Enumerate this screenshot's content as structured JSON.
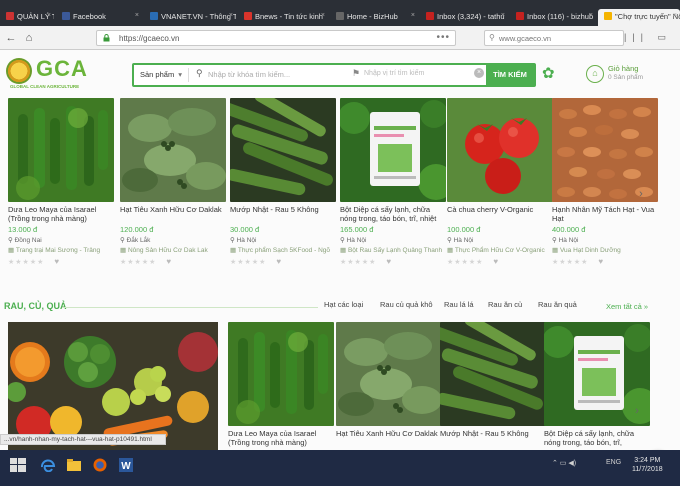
{
  "browser": {
    "tabs": [
      {
        "label": "QUẢN LÝ TÒA S",
        "icon": "page-icon",
        "color": "#cc3333"
      },
      {
        "label": "Facebook",
        "icon": "facebook-icon",
        "color": "#3b5998"
      },
      {
        "label": "VNANET.VN - Thông Tấn",
        "icon": "page-icon",
        "color": "#2a6db5"
      },
      {
        "label": "Bnews - Tin tức kinh",
        "icon": "page-icon",
        "color": "#d9342b"
      },
      {
        "label": "Home - BizHub",
        "icon": "page-icon",
        "color": "#666666"
      },
      {
        "label": "Inbox (3,324) - tathu",
        "icon": "mail-icon",
        "color": "#c5221f"
      },
      {
        "label": "Inbox (116) - bizhub",
        "icon": "mail-icon",
        "color": "#c5221f"
      },
      {
        "label": "\"Chợ trực tuyến\" Nô",
        "icon": "page-icon",
        "color": "#f5b400"
      }
    ],
    "url": "https://gcaeco.vn",
    "search_query": "www.gcaeco.vn"
  },
  "site": {
    "logo_text": "GCA",
    "logo_sub": "GLOBAL CLEAN AGRICULTURE",
    "search": {
      "category": "Sản phẩm",
      "keyword_placeholder": "Nhập từ khóa tìm kiếm...",
      "location_placeholder": "Nhập vị trí tìm kiếm",
      "button": "TÌM KIẾM"
    },
    "cart": {
      "label": "Giỏ hàng",
      "count": "0 Sản phẩm"
    },
    "row1": [
      {
        "name": "Dưa Leo Maya của Isarael (Trồng trong nhà màng)",
        "price": "13.000 đ",
        "place": "Đồng Nai",
        "shop": "Trang trại Mai Sương - Trảng",
        "img": "cucumber"
      },
      {
        "name": "Hạt Tiêu Xanh Hữu Cơ Daklak",
        "price": "120.000 đ",
        "place": "Đắk Lắk",
        "shop": "Nông Sản Hữu Cơ Dak Lak",
        "img": "pepper"
      },
      {
        "name": "Mướp Nhật - Rau 5 Không",
        "price": "30.000 đ",
        "place": "Hà Nội",
        "shop": "Thực phẩm Sạch 5KFood - Ngõ",
        "img": "luffa"
      },
      {
        "name": "Bột Diệp cá sấy lạnh, chữa nóng trong, táo bón, trĩ, nhiệt",
        "price": "165.000 đ",
        "place": "Hà Nội",
        "shop": "Bột Rau Sấy Lạnh Quảng Thanh",
        "img": "powder"
      },
      {
        "name": "Cà chua cherry V-Organic",
        "price": "100.000 đ",
        "place": "Hà Nội",
        "shop": "Thực Phẩm Hữu Cơ V-Organic",
        "img": "tomato"
      },
      {
        "name": "Hạnh Nhân Mỹ Tách Hạt - Vua Hạt",
        "price": "400.000 đ",
        "place": "Hà Nội",
        "shop": "Vua Hạt Dinh Dưỡng",
        "img": "almond"
      }
    ],
    "section": {
      "title": "RAU, CỦ, QUẢ",
      "nav": [
        "Hạt các loại",
        "Rau củ quả khô",
        "Rau lá lá",
        "Rau ăn củ",
        "Rau ăn quả"
      ],
      "see_more": "Xem tất cả »"
    },
    "row2": [
      {
        "name": "Dưa Leo Maya của Isarael (Trồng trong nhà màng)",
        "img": "cucumber"
      },
      {
        "name": "Hạt Tiêu Xanh Hữu Cơ Daklak",
        "img": "pepper"
      },
      {
        "name": "Mướp Nhật - Rau 5 Không",
        "img": "luffa"
      },
      {
        "name": "Bột Diệp cá sấy lạnh, chữa nóng trong, táo bón, trĩ,",
        "img": "powder"
      }
    ],
    "status_url": "...vn/hanh-nhan-my-tach-hat---vua-hat-p10491.html"
  },
  "taskbar": {
    "lang": "ENG",
    "time": "3:24 PM",
    "date": "11/7/2018"
  }
}
